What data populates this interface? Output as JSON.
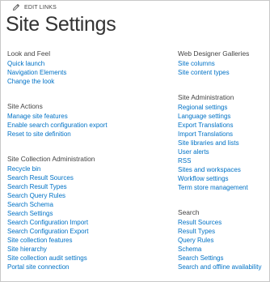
{
  "edit_links_label": "EDIT LINKS",
  "page_title": "Site Settings",
  "left_column": [
    {
      "heading": "Look and Feel",
      "links": [
        "Quick launch",
        "Navigation Elements",
        "Change the look"
      ]
    },
    {
      "heading": "Site Actions",
      "links": [
        "Manage site features",
        "Enable search configuration export",
        "Reset to site definition"
      ]
    },
    {
      "heading": "Site Collection Administration",
      "links": [
        "Recycle bin",
        "Search Result Sources",
        "Search Result Types",
        "Search Query Rules",
        "Search Schema",
        "Search Settings",
        "Search Configuration Import",
        "Search Configuration Export",
        "Site collection features",
        "Site hierarchy",
        "Site collection audit settings",
        "Portal site connection"
      ]
    }
  ],
  "right_column": [
    {
      "heading": "Web Designer Galleries",
      "links": [
        "Site columns",
        "Site content types"
      ]
    },
    {
      "heading": "Site Administration",
      "links": [
        "Regional settings",
        "Language settings",
        "Export Translations",
        "Import Translations",
        "Site libraries and lists",
        "User alerts",
        "RSS",
        "Sites and workspaces",
        "Workflow settings",
        "Term store management"
      ]
    },
    {
      "heading": "Search",
      "links": [
        "Result Sources",
        "Result Types",
        "Query Rules",
        "Schema",
        "Search Settings",
        "Search and offline availability"
      ]
    }
  ],
  "colors": {
    "link": "#0072c6",
    "heading": "#444444",
    "title": "#333333"
  }
}
